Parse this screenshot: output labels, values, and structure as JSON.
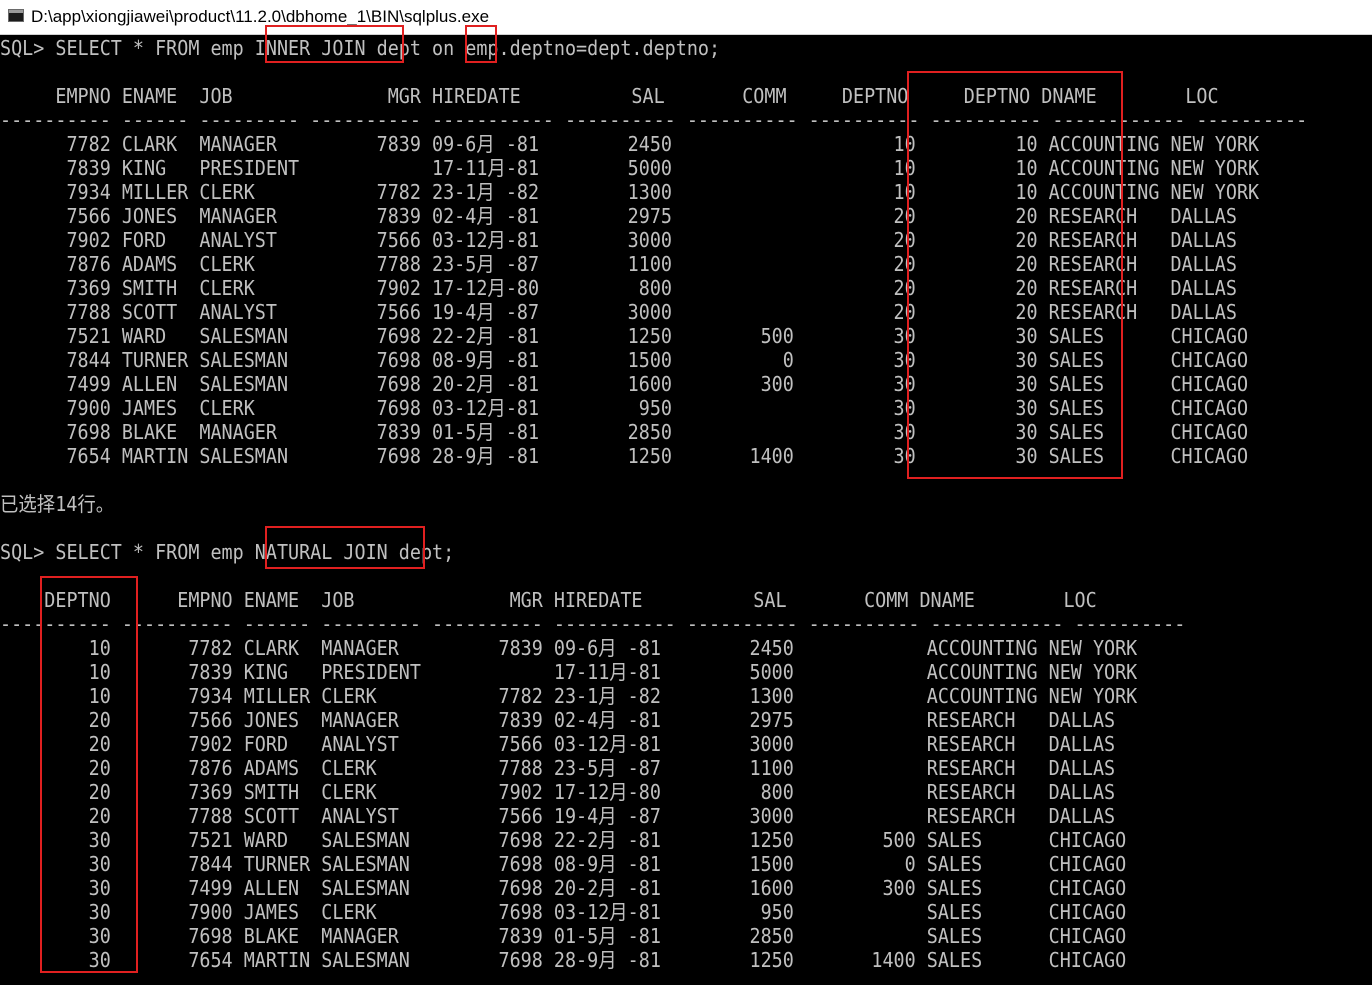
{
  "window": {
    "title": "D:\\app\\xiongjiawei\\product\\11.2.0\\dbhome_1\\BIN\\sqlplus.exe"
  },
  "console": {
    "lines": [
      "SQL> SELECT * FROM emp INNER JOIN dept on emp.deptno=dept.deptno;",
      "",
      "     EMPNO ENAME  JOB              MGR HIREDATE          SAL       COMM     DEPTNO     DEPTNO DNAME        LOC",
      "---------- ------ --------- ---------- ----------- ---------- ---------- ---------- ---------- ------------ ----------",
      "      7782 CLARK  MANAGER         7839 09-6月 -81        2450                    10         10 ACCOUNTING NEW YORK",
      "      7839 KING   PRESIDENT            17-11月-81        5000                    10         10 ACCOUNTING NEW YORK",
      "      7934 MILLER CLERK           7782 23-1月 -82        1300                    10         10 ACCOUNTING NEW YORK",
      "      7566 JONES  MANAGER         7839 02-4月 -81        2975                    20         20 RESEARCH   DALLAS",
      "      7902 FORD   ANALYST         7566 03-12月-81        3000                    20         20 RESEARCH   DALLAS",
      "      7876 ADAMS  CLERK           7788 23-5月 -87        1100                    20         20 RESEARCH   DALLAS",
      "      7369 SMITH  CLERK           7902 17-12月-80         800                    20         20 RESEARCH   DALLAS",
      "      7788 SCOTT  ANALYST         7566 19-4月 -87        3000                    20         20 RESEARCH   DALLAS",
      "      7521 WARD   SALESMAN        7698 22-2月 -81        1250        500         30         30 SALES      CHICAGO",
      "      7844 TURNER SALESMAN        7698 08-9月 -81        1500          0         30         30 SALES      CHICAGO",
      "      7499 ALLEN  SALESMAN        7698 20-2月 -81        1600        300         30         30 SALES      CHICAGO",
      "      7900 JAMES  CLERK           7698 03-12月-81         950                    30         30 SALES      CHICAGO",
      "      7698 BLAKE  MANAGER         7839 01-5月 -81        2850                    30         30 SALES      CHICAGO",
      "      7654 MARTIN SALESMAN        7698 28-9月 -81        1250       1400         30         30 SALES      CHICAGO",
      "",
      "已选择14行。",
      "",
      "SQL> SELECT * FROM emp NATURAL JOIN dept;",
      "",
      "    DEPTNO      EMPNO ENAME  JOB              MGR HIREDATE          SAL       COMM DNAME        LOC",
      "---------- ---------- ------ --------- ---------- ----------- ---------- ---------- ------------ ----------",
      "        10       7782 CLARK  MANAGER         7839 09-6月 -81        2450            ACCOUNTING NEW YORK",
      "        10       7839 KING   PRESIDENT            17-11月-81        5000            ACCOUNTING NEW YORK",
      "        10       7934 MILLER CLERK           7782 23-1月 -82        1300            ACCOUNTING NEW YORK",
      "        20       7566 JONES  MANAGER         7839 02-4月 -81        2975            RESEARCH   DALLAS",
      "        20       7902 FORD   ANALYST         7566 03-12月-81        3000            RESEARCH   DALLAS",
      "        20       7876 ADAMS  CLERK           7788 23-5月 -87        1100            RESEARCH   DALLAS",
      "        20       7369 SMITH  CLERK           7902 17-12月-80         800            RESEARCH   DALLAS",
      "        20       7788 SCOTT  ANALYST         7566 19-4月 -87        3000            RESEARCH   DALLAS",
      "        30       7521 WARD   SALESMAN        7698 22-2月 -81        1250        500 SALES      CHICAGO",
      "        30       7844 TURNER SALESMAN        7698 08-9月 -81        1500          0 SALES      CHICAGO",
      "        30       7499 ALLEN  SALESMAN        7698 20-2月 -81        1600        300 SALES      CHICAGO",
      "        30       7900 JAMES  CLERK           7698 03-12月-81         950            SALES      CHICAGO",
      "        30       7698 BLAKE  MANAGER         7839 01-5月 -81        2850            SALES      CHICAGO",
      "        30       7654 MARTIN SALESMAN        7698 28-9月 -81        1250       1400 SALES      CHICAGO"
    ]
  },
  "colors": {
    "background": "#000000",
    "text": "#c0c0c0",
    "highlight": "#e02020",
    "titlebar": "#ffffff"
  }
}
